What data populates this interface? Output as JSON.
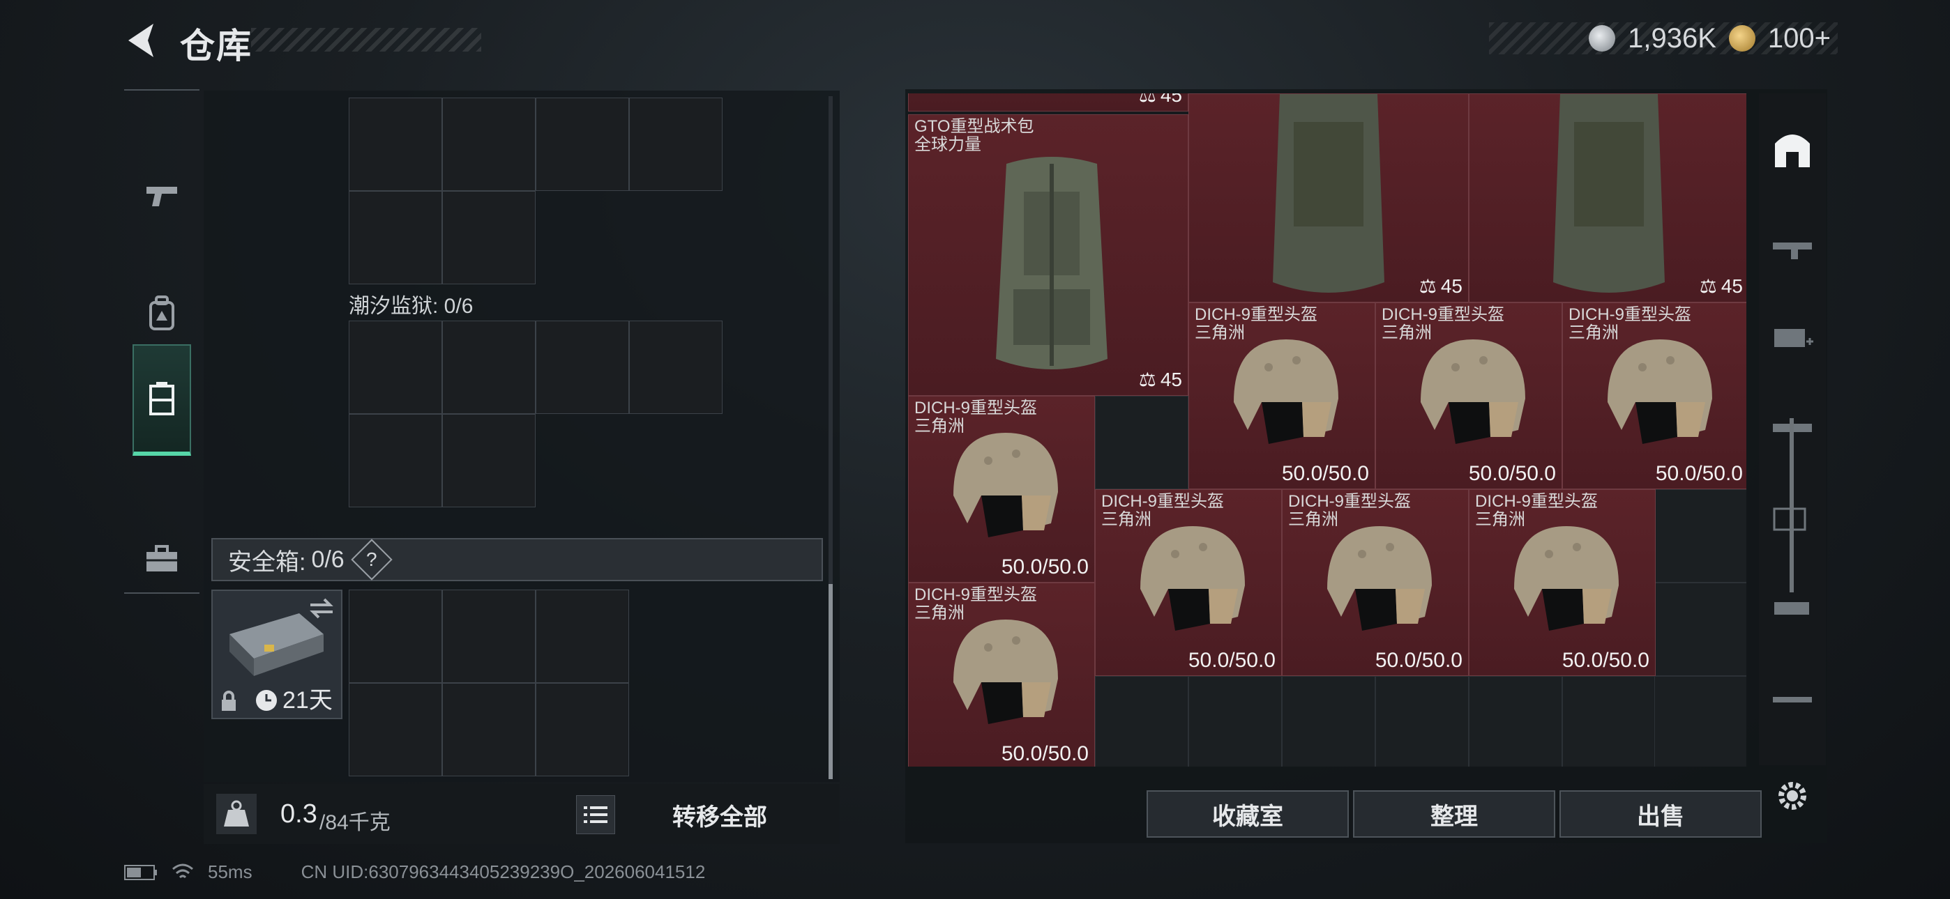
{
  "header": {
    "title": "仓库",
    "silver_amount": "1,936K",
    "gold_amount": "100+"
  },
  "left": {
    "tide_prison_label": "潮汐监狱: 0/6",
    "safe_box_label": "安全箱:",
    "safe_box_count": "0/6",
    "help_mark": "?",
    "case_days": "21天",
    "weight_value": "0.3",
    "weight_max": "/84千克",
    "transfer_all": "转移全部"
  },
  "items": {
    "backpack_name": "GTO重型战术包",
    "backpack_sub": "全球力量",
    "backpack_weight": "45",
    "helmet_name": "DICH-9重型头盔",
    "helmet_sub": "三角洲",
    "helmet_durability": "50.0/50.0"
  },
  "buttons": {
    "collection": "收藏室",
    "organize": "整理",
    "sell": "出售"
  },
  "status": {
    "ping": "55ms",
    "uid": "CN UID:6307963443405239239O_202606041512"
  },
  "colors": {
    "accent_green": "#56d6a8",
    "item_red": "#5a2127"
  }
}
